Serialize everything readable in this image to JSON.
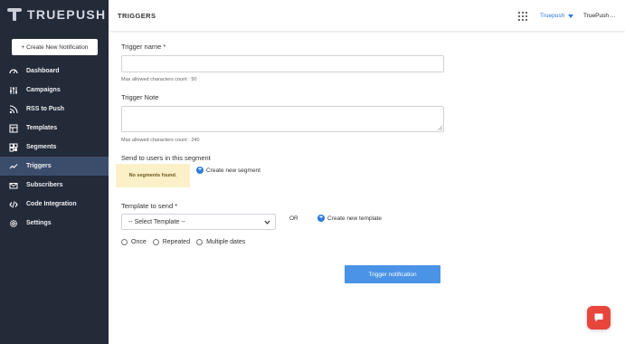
{
  "app": {
    "brand": "TRUEPUSH"
  },
  "header": {
    "title": "TRIGGERS",
    "account": "Truepush",
    "user": "TruePush ..."
  },
  "sidebar": {
    "create_label": "+ Create New Notification",
    "items": [
      {
        "label": "Dashboard",
        "icon": "dashboard-icon"
      },
      {
        "label": "Campaigns",
        "icon": "sliders-icon"
      },
      {
        "label": "RSS to Push",
        "icon": "rss-icon"
      },
      {
        "label": "Templates",
        "icon": "template-icon"
      },
      {
        "label": "Segments",
        "icon": "segments-icon"
      },
      {
        "label": "Triggers",
        "icon": "trigger-icon",
        "active": true
      },
      {
        "label": "Subscribers",
        "icon": "subscribers-icon"
      },
      {
        "label": "Code Integration",
        "icon": "code-icon"
      },
      {
        "label": "Settings",
        "icon": "gear-icon"
      }
    ]
  },
  "form": {
    "trigger_name": {
      "label": "Trigger name",
      "required_mark": "*",
      "value": "",
      "hint": "Max allowed characters count : 50"
    },
    "trigger_note": {
      "label": "Trigger Note",
      "value": "",
      "hint": "Max allowed characters count : 240"
    },
    "segment": {
      "label": "Send to users in this segment",
      "empty_message": "No segments found.",
      "create_link": "Create new segment"
    },
    "template": {
      "label": "Template to send",
      "required_mark": "*",
      "selected": "-- Select Template --",
      "or_text": "OR",
      "create_link": "Create new template"
    },
    "schedule_options": [
      "Once",
      "Repeated",
      "Multiple dates"
    ],
    "submit_label": "Trigger notification"
  },
  "colors": {
    "sidebar_bg": "#232a38",
    "active_item": "#3c4d6c",
    "accent": "#4b93e6",
    "chat": "#e8453c",
    "warning_bg": "#fbf0c8"
  }
}
